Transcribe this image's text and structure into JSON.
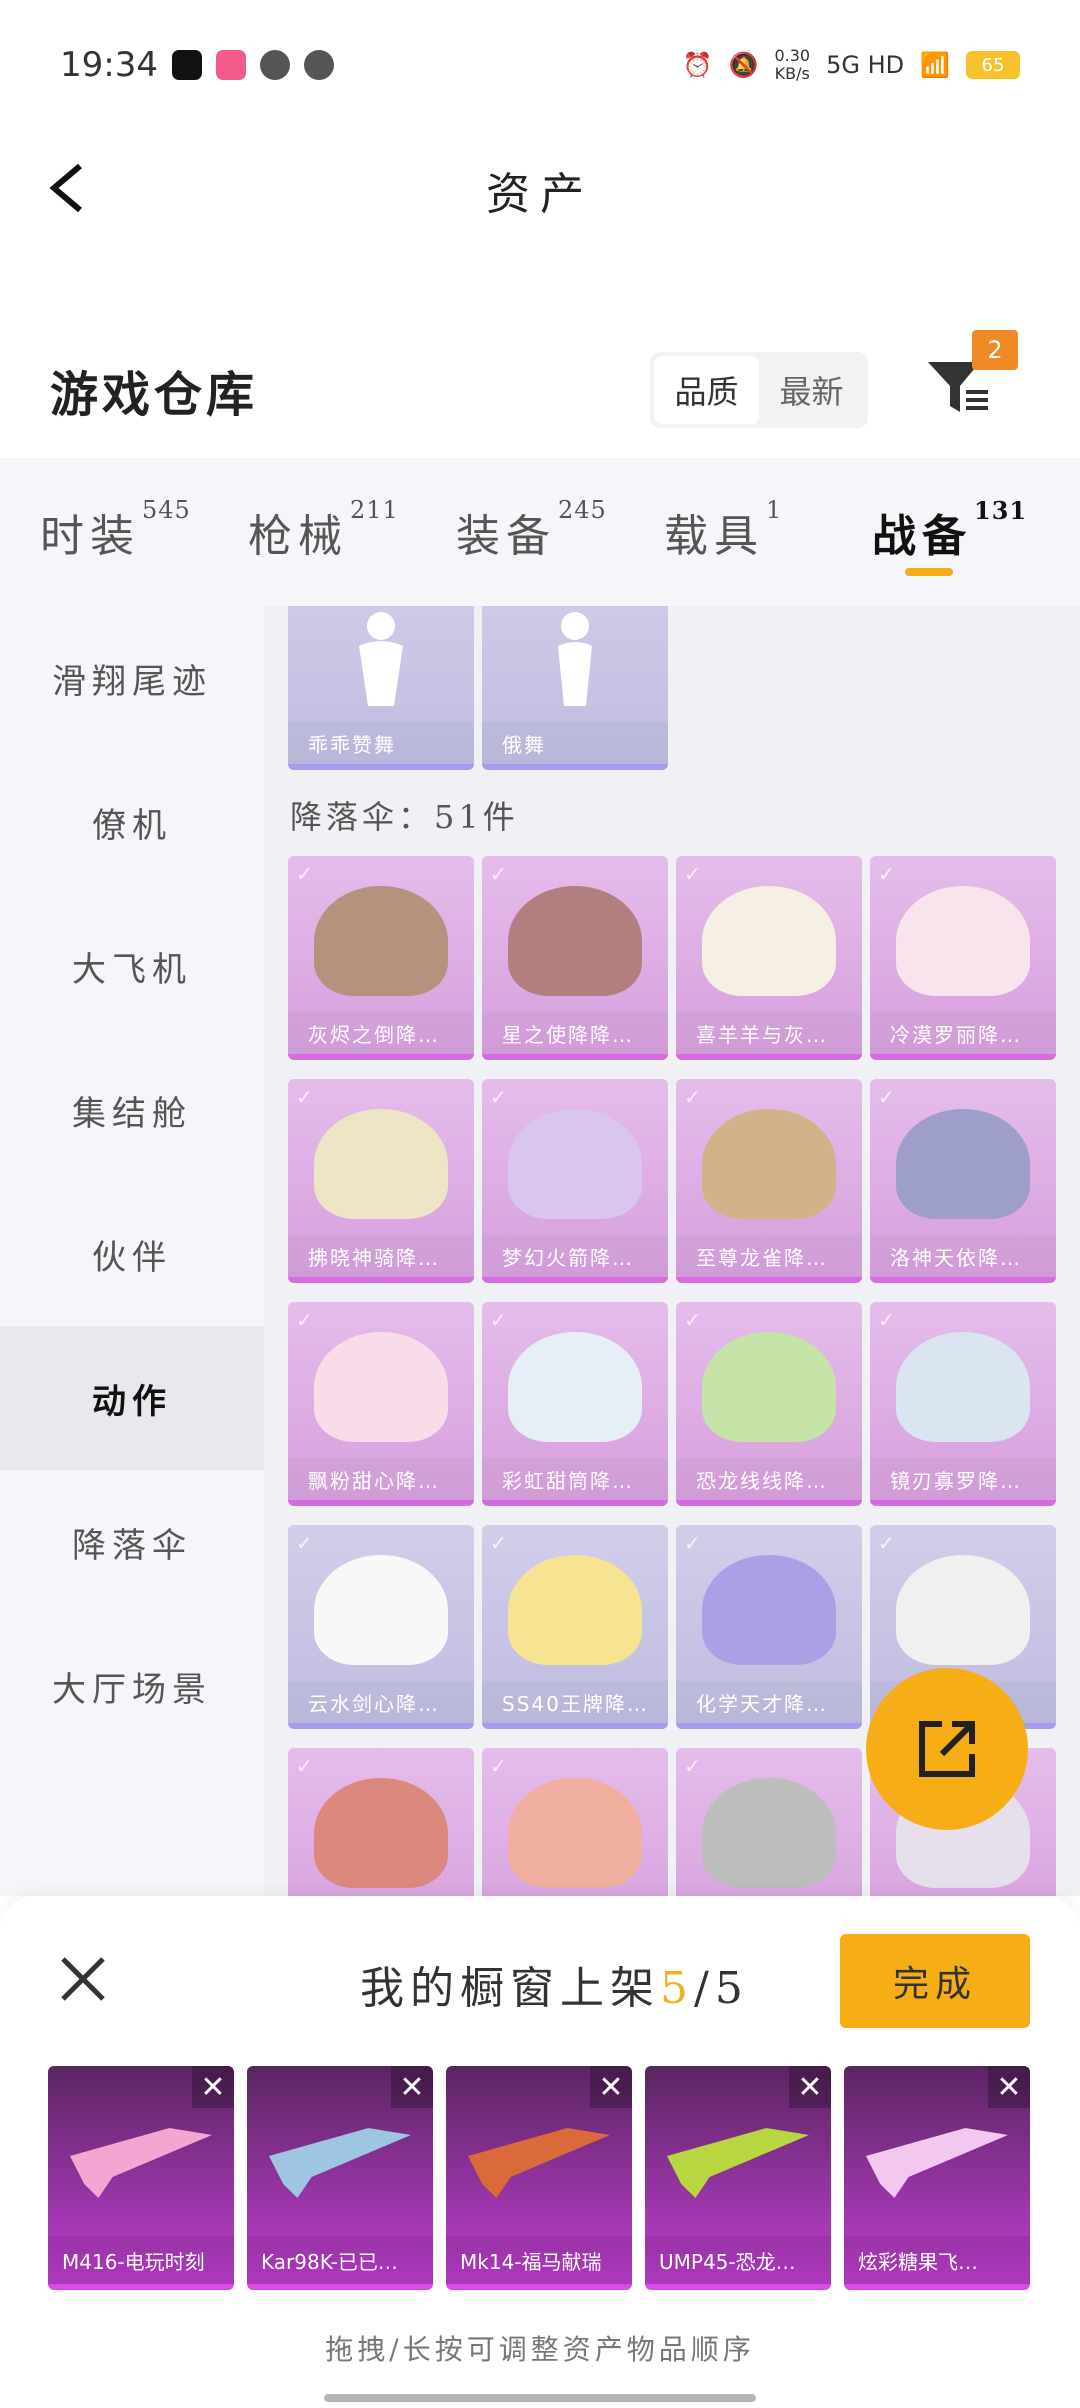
{
  "status_bar": {
    "time": "19:34",
    "net_speed_value": "0.30",
    "net_speed_unit": "KB/s",
    "network": "5G HD",
    "battery": "65"
  },
  "header": {
    "title": "资产"
  },
  "section": {
    "title": "游戏仓库",
    "sort_quality": "品质",
    "sort_latest": "最新",
    "filter_badge": "2"
  },
  "tabs": [
    {
      "label": "时装",
      "count": "545"
    },
    {
      "label": "枪械",
      "count": "211"
    },
    {
      "label": "装备",
      "count": "245"
    },
    {
      "label": "载具",
      "count": "1"
    },
    {
      "label": "战备",
      "count": "131"
    }
  ],
  "sidebar": [
    {
      "label": "滑翔尾迹"
    },
    {
      "label": "僚机"
    },
    {
      "label": "大飞机"
    },
    {
      "label": "集结舱"
    },
    {
      "label": "伙伴"
    },
    {
      "label": "动作"
    },
    {
      "label": "降落伞"
    },
    {
      "label": "大厅场景"
    }
  ],
  "emotes": [
    {
      "name": "乖乖赞舞"
    },
    {
      "name": "俄舞"
    }
  ],
  "parachute_header": "降落伞：51件",
  "parachutes": [
    {
      "name": "灰烬之倒降…",
      "color": "#8a5a3a"
    },
    {
      "name": "星之使降降…",
      "color": "#8b3a3a"
    },
    {
      "name": "喜羊羊与灰…",
      "color": "#f1e9d6"
    },
    {
      "name": "冷漠罗丽降…",
      "color": "#f3d6e4"
    },
    {
      "name": "拂晓神骑降…",
      "color": "#e5d7a8"
    },
    {
      "name": "梦幻火箭降…",
      "color": "#c7a7e5"
    },
    {
      "name": "至尊龙雀降…",
      "color": "#b88b4a"
    },
    {
      "name": "洛神天依降…",
      "color": "#6a6ab0"
    },
    {
      "name": "飘粉甜心降…",
      "color": "#f6c8df"
    },
    {
      "name": "彩虹甜筒降…",
      "color": "#dbe6f2"
    },
    {
      "name": "恐龙线线降…",
      "color": "#a8d67a"
    },
    {
      "name": "镜刃寡罗降…",
      "color": "#c6d8ea"
    },
    {
      "name": "云水剑心降…",
      "color": "#f4f4f4"
    },
    {
      "name": "SS40王牌降…",
      "color": "#f2d65a"
    },
    {
      "name": "化学天才降…",
      "color": "#7d6dd9"
    },
    {
      "name": "",
      "color": "#e8e8e8"
    },
    {
      "name": "",
      "color": "#c84a38"
    },
    {
      "name": "",
      "color": "#e8856c"
    },
    {
      "name": "",
      "color": "#9a9a9a"
    },
    {
      "name": "",
      "color": "#d8cfe0"
    }
  ],
  "sheet": {
    "title_prefix": "我的橱窗上架",
    "current": "5",
    "total": "/5",
    "done_label": "完成",
    "hint": "拖拽/长按可调整资产物品顺序",
    "items": [
      {
        "name": "M416-电玩时刻",
        "color": "#f3a6d2"
      },
      {
        "name": "Kar98K-已已…",
        "color": "#9ec6e2"
      },
      {
        "name": "Mk14-福马献瑞",
        "color": "#d96a3a"
      },
      {
        "name": "UMP45-恐龙…",
        "color": "#b8d640"
      },
      {
        "name": "炫彩糖果飞…",
        "color": "#f3c8f0"
      }
    ]
  }
}
